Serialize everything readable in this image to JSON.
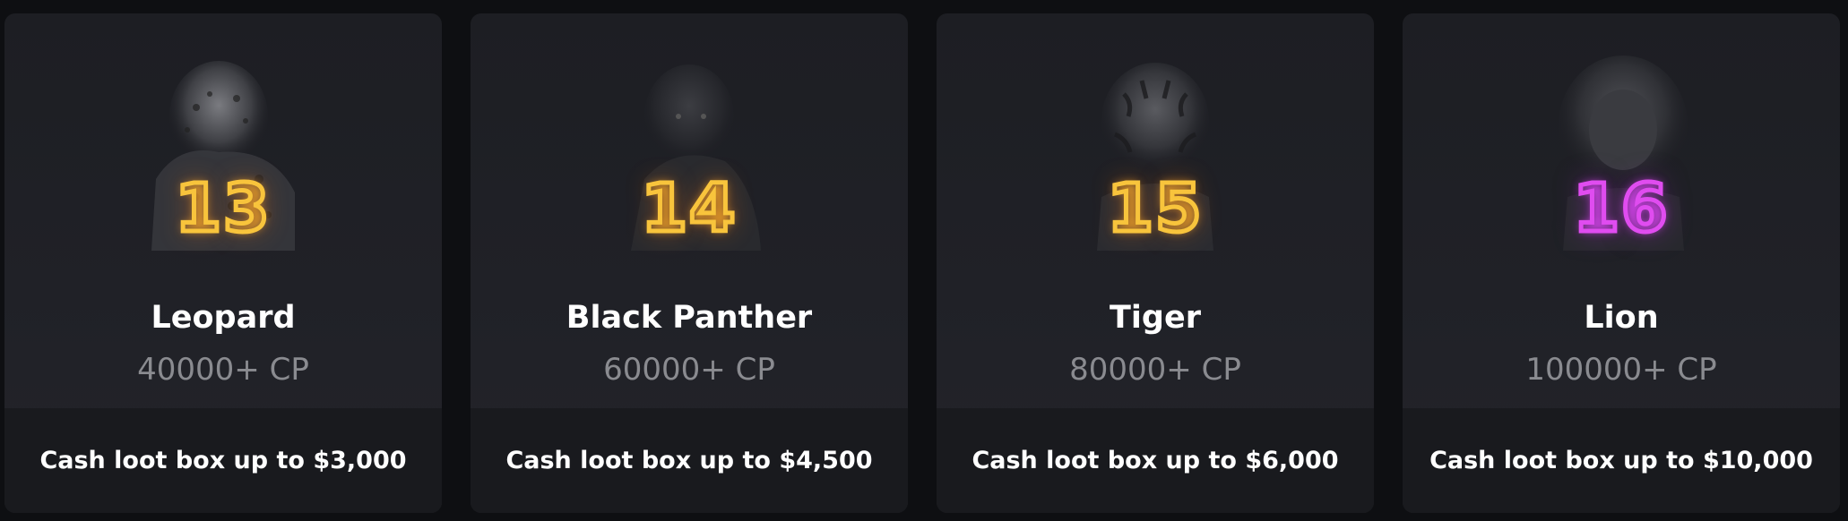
{
  "tiers": [
    {
      "level": "13",
      "name": "Leopard",
      "cp": "40000+ CP",
      "reward": "Cash loot box up to $3,000",
      "glow": "#f7b23a",
      "animal": "leopard-icon"
    },
    {
      "level": "14",
      "name": "Black Panther",
      "cp": "60000+ CP",
      "reward": "Cash loot box up to $4,500",
      "glow": "#f7b23a",
      "animal": "panther-icon"
    },
    {
      "level": "15",
      "name": "Tiger",
      "cp": "80000+ CP",
      "reward": "Cash loot box up to $6,000",
      "glow": "#f8c43c",
      "animal": "tiger-icon"
    },
    {
      "level": "16",
      "name": "Lion",
      "cp": "100000+ CP",
      "reward": "Cash loot box up to $10,000",
      "glow": "#e04cf0",
      "animal": "lion-icon"
    }
  ]
}
